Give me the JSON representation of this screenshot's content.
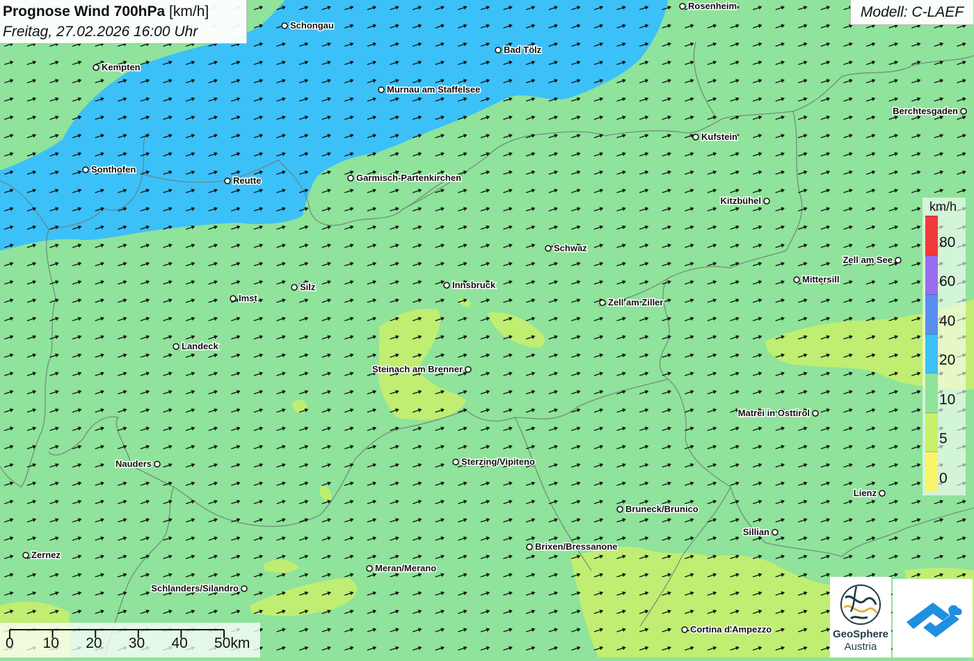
{
  "title": {
    "main": "Prognose Wind 700hPa",
    "unit": "[km/h]",
    "datetime": "Freitag, 27.02.2026 16:00 Uhr"
  },
  "model": "Modell: C-LAEF",
  "legend": {
    "unit": "km/h",
    "levels": [
      {
        "label": "80",
        "color": "#f03a3a"
      },
      {
        "label": "60",
        "color": "#9b6bf0"
      },
      {
        "label": "40",
        "color": "#5a8df0"
      },
      {
        "label": "20",
        "color": "#3cc0f8"
      },
      {
        "label": "10",
        "color": "#8fe39b"
      },
      {
        "label": "5",
        "color": "#c8f06b"
      },
      {
        "label": "0",
        "color": "#f8f56b"
      }
    ]
  },
  "scalebar": {
    "labels": [
      "0",
      "10",
      "20",
      "30",
      "40",
      "50km"
    ]
  },
  "logos": {
    "geosphere_line1": "GeoSphere",
    "geosphere_line2": "Austria"
  },
  "cities": [
    {
      "name": "Rosenheim"
    },
    {
      "name": "Schongau"
    },
    {
      "name": "Bad Tölz"
    },
    {
      "name": "Kempten"
    },
    {
      "name": "Murnau am Staffelsee"
    },
    {
      "name": "Berchtesgaden"
    },
    {
      "name": "Kufstein"
    },
    {
      "name": "Sonthofen"
    },
    {
      "name": "Reutte"
    },
    {
      "name": "Garmisch-Partenkirchen"
    },
    {
      "name": "Kitzbühel"
    },
    {
      "name": "Schwaz"
    },
    {
      "name": "Zell am See"
    },
    {
      "name": "Mittersill"
    },
    {
      "name": "Silz"
    },
    {
      "name": "Innsbruck"
    },
    {
      "name": "Imst"
    },
    {
      "name": "Zell am Ziller"
    },
    {
      "name": "Landeck"
    },
    {
      "name": "Steinach am Brenner"
    },
    {
      "name": "Matrei in Osttirol"
    },
    {
      "name": "Nauders"
    },
    {
      "name": "Sterzing/Vipiteno"
    },
    {
      "name": "Lienz"
    },
    {
      "name": "Bruneck/Brunico"
    },
    {
      "name": "Sillian"
    },
    {
      "name": "Brixen/Bressanone"
    },
    {
      "name": "Zernez"
    },
    {
      "name": "Meran/Merano"
    },
    {
      "name": "Schlanders/Silandro"
    },
    {
      "name": "Cortina d'Ampezzo"
    }
  ]
}
